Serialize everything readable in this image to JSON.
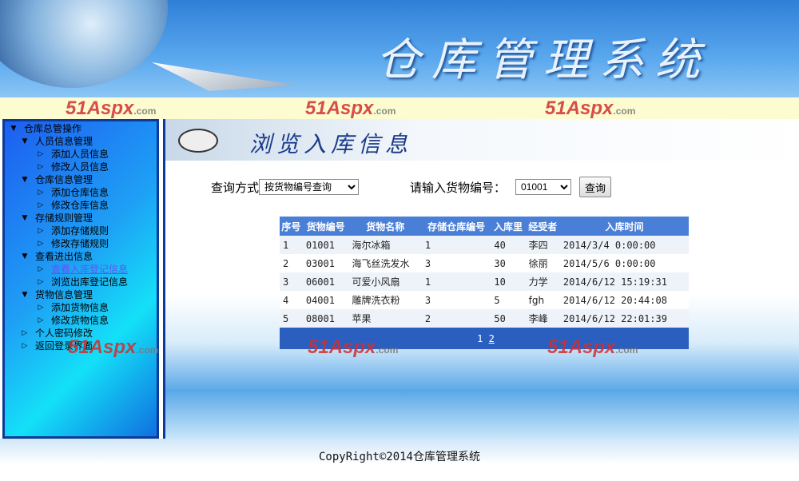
{
  "header": {
    "system_title": "仓库管理系统",
    "watermark": "51Aspx",
    ".com": ".com",
    "watermark_suffix": ".com"
  },
  "sidebar": {
    "root": "仓库总管操作",
    "groups": [
      {
        "label": "人员信息管理",
        "items": [
          "添加人员信息",
          "修改人员信息"
        ]
      },
      {
        "label": "仓库信息管理",
        "items": [
          "添加仓库信息",
          "修改仓库信息"
        ]
      },
      {
        "label": "存储规则管理",
        "items": [
          "添加存储规则",
          "修改存储规则"
        ]
      },
      {
        "label": "查看进出信息",
        "items": [
          "查看入库登记信息",
          "浏览出库登记信息"
        ]
      },
      {
        "label": "货物信息管理",
        "items": [
          "添加货物信息",
          "修改货物信息"
        ]
      }
    ],
    "extra": [
      "个人密码修改",
      "返回登录界面"
    ]
  },
  "main": {
    "page_title": "浏览入库信息",
    "query_label": "查询方式",
    "query_mode": "按货物编号查询",
    "input_label": "请输入货物编号：",
    "goods_code": "01001",
    "query_button": "查询",
    "table": {
      "headers": [
        "序号",
        "货物编号",
        "货物名称",
        "存储仓库编号",
        "入库里",
        "经受者",
        "入库时间"
      ],
      "rows": [
        [
          "1",
          "01001",
          "海尔冰箱",
          "1",
          "40",
          "李四",
          "2014/3/4 0:00:00"
        ],
        [
          "2",
          "03001",
          "海飞丝洗发水",
          "3",
          "30",
          "徐丽",
          "2014/5/6 0:00:00"
        ],
        [
          "3",
          "06001",
          "可爱小风扇",
          "1",
          "10",
          "力学",
          "2014/6/12 15:19:31"
        ],
        [
          "4",
          "04001",
          "雕牌洗衣粉",
          "3",
          "5",
          "fgh",
          "2014/6/12 20:44:08"
        ],
        [
          "5",
          "08001",
          "苹果",
          "2",
          "50",
          "李峰",
          "2014/6/12 22:01:39"
        ]
      ],
      "pages": [
        "1",
        "2"
      ]
    }
  },
  "footer": {
    "copyright": "CopyRight©2014仓库管理系统"
  }
}
